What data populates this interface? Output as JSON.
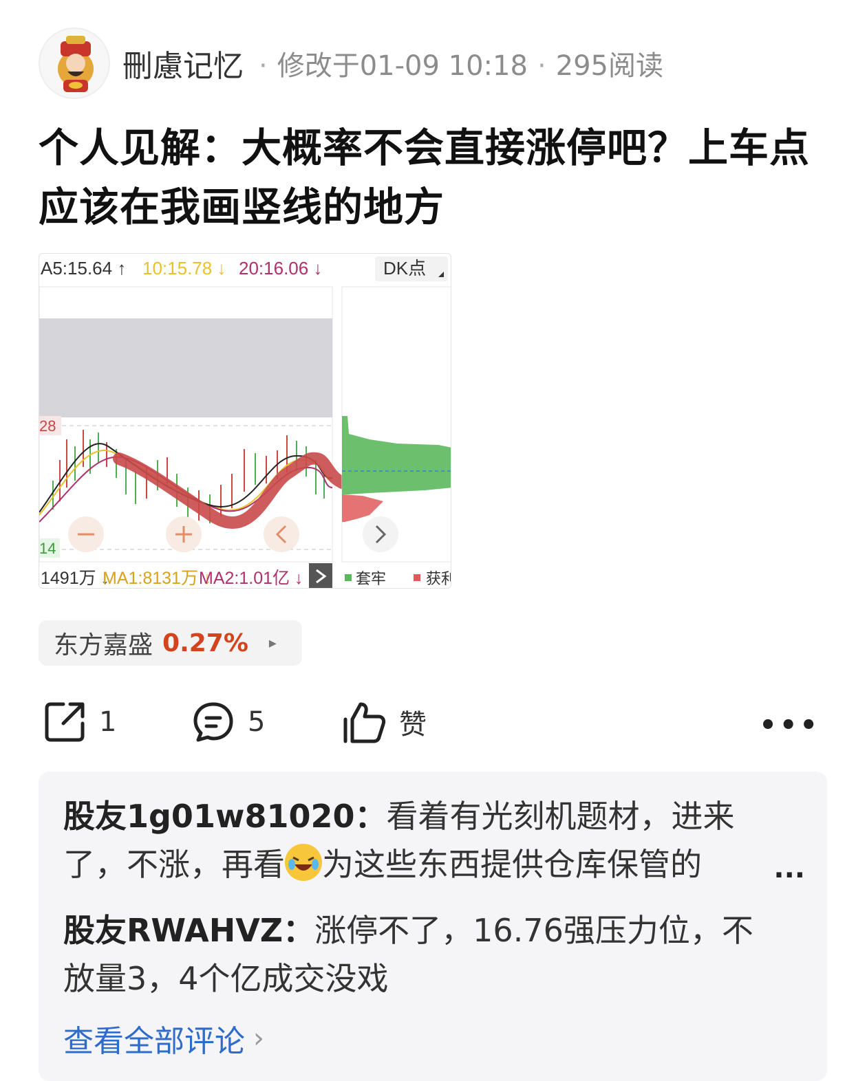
{
  "header": {
    "author": "刪慮记忆",
    "modified": "修改于01-09 10:18",
    "reads": "295阅读",
    "separator": "·"
  },
  "post": {
    "title": "个人见解：大概率不会直接涨停吧？上车点应该在我画竖线的地方"
  },
  "chart_image": {
    "ma_bar": {
      "a5": "A5:15.64 ↑",
      "a10": "10:15.78 ↓",
      "a20": "20:16.06 ↓",
      "dk_button": "DK点"
    },
    "y_label_top": "28",
    "y_label_bottom": "14",
    "volume_bar": {
      "vol": "1491万 ↓",
      "ma1": "MA1:8131万 ↓",
      "ma2": "MA2:1.01亿 ↓"
    },
    "legend": {
      "trapped": "套牢",
      "profit": "获利"
    },
    "colors": {
      "a5": "#333333",
      "a10": "#e8c22a",
      "a20": "#b0306a",
      "ma1": "#d9a21c",
      "ma2": "#b0306a",
      "up": "#4caf50",
      "annotation": "#c94a4a"
    }
  },
  "stock_tag": {
    "name": "东方嘉盛",
    "change": "0.27%",
    "arrow": "▸"
  },
  "actions": {
    "share_count": "1",
    "comment_count": "5",
    "like_label": "赞",
    "more": "•••"
  },
  "comments": [
    {
      "user": "股友1g01w81020：",
      "text_before": "看着有光刻机题材，进来了，不涨，再看",
      "text_after": "为这些东西提供仓库保管的",
      "ellipsis": "..."
    },
    {
      "user": "股友RWAHVZ：",
      "text": "涨停不了，16.76强压力位，不放量3，4个亿成交没戏"
    }
  ],
  "see_all": "查看全部评论",
  "see_all_chevron": "›"
}
